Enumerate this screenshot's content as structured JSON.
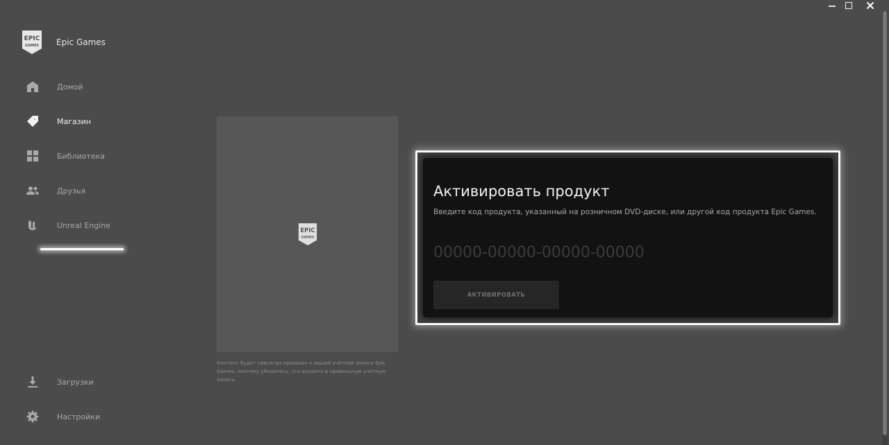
{
  "app": {
    "name": "Epic Games"
  },
  "logo": {
    "line1": "EPIC",
    "line2": "GAMES"
  },
  "sidebar": {
    "items": [
      {
        "label": "Домой",
        "icon": "home-icon"
      },
      {
        "label": "Магазин",
        "icon": "tag-icon",
        "active": true
      },
      {
        "label": "Библиотека",
        "icon": "grid-icon"
      },
      {
        "label": "Друзья",
        "icon": "friends-icon"
      },
      {
        "label": "Unreal Engine",
        "icon": "unreal-icon"
      }
    ],
    "bottom": [
      {
        "label": "Загрузки",
        "icon": "download-icon"
      },
      {
        "label": "Настройки",
        "icon": "gear-icon"
      }
    ]
  },
  "window_controls": [
    "minimize-icon",
    "maximize-icon",
    "close-icon"
  ],
  "product": {
    "disclaimer": "Контент будет навсегда привязан к вашей учётной записи Epic Games, поэтому убедитесь, что входите в правильную учётную запись."
  },
  "activation": {
    "title": "Активировать продукт",
    "description": "Введите код продукта, указанный на розничном DVD-диске, или другой код продукта Epic Games.",
    "code_placeholder": "00000-00000-00000-00000",
    "code_value": "",
    "button_label": "АКТИВИРОВАТЬ"
  },
  "colors": {
    "background": "#4b4b4b",
    "card": "#121212",
    "highlight": "#fbfaf6",
    "button": "#262626"
  }
}
